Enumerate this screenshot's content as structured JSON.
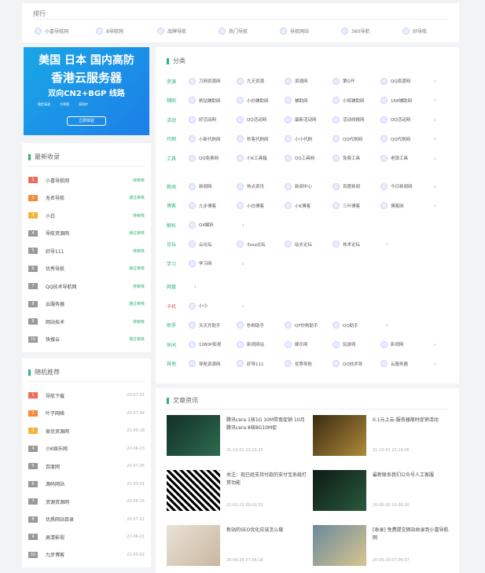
{
  "rank": {
    "title": "排行",
    "items": [
      "小喜导航网",
      "8导航网",
      "品牌导航",
      "热门导航",
      "导航网站",
      "360导航",
      "好导航"
    ]
  },
  "ad": {
    "line1": "美国 日本 国内高防",
    "line2": "香港云服务器",
    "line3": "双向CN2+BGP 线路",
    "chips": [
      "稳定高速",
      "大带宽",
      "高防护"
    ],
    "button": "立即体验"
  },
  "latest": {
    "title": "最新收录",
    "rows": [
      {
        "n": "1",
        "name": "小喜导航网",
        "status": "待审核"
      },
      {
        "n": "2",
        "name": "无名导航",
        "status": "通过审核"
      },
      {
        "n": "3",
        "name": "小白",
        "status": "待审核"
      },
      {
        "n": "4",
        "name": "导航资源网",
        "status": "通过审核"
      },
      {
        "n": "5",
        "name": "好导111",
        "status": "待审核"
      },
      {
        "n": "6",
        "name": "优秀导航",
        "status": "通过审核"
      },
      {
        "n": "7",
        "name": "QQ技术导航网",
        "status": "待审核"
      },
      {
        "n": "8",
        "name": "云服务器",
        "status": "通过审核"
      },
      {
        "n": "9",
        "name": "网站技术",
        "status": "待审核"
      },
      {
        "n": "10",
        "name": "快搜云",
        "status": "通过审核"
      }
    ]
  },
  "random": {
    "title": "随机推荐",
    "rows": [
      {
        "n": "1",
        "name": "导航下载",
        "date": "20-07-01"
      },
      {
        "n": "2",
        "name": "叶子网络",
        "date": "20-07-04"
      },
      {
        "n": "3",
        "name": "易优资源网",
        "date": "21-05-18"
      },
      {
        "n": "4",
        "name": "小K娱乐网",
        "date": "20-06-23"
      },
      {
        "n": "5",
        "name": "百度网",
        "date": "20-07-05"
      },
      {
        "n": "6",
        "name": "源码网站",
        "date": "21-03-01"
      },
      {
        "n": "7",
        "name": "资源资源网",
        "date": "20-06-25"
      },
      {
        "n": "8",
        "name": "优质网站目录",
        "date": "20-07-01"
      },
      {
        "n": "9",
        "name": "高清影视",
        "date": "21-06-21"
      },
      {
        "n": "10",
        "name": "九步博客",
        "date": "21-05-02"
      }
    ]
  },
  "categories": {
    "title": "分类",
    "rows": [
      {
        "label": "资源",
        "red": false,
        "items": [
          "刀网资源网",
          "九天资源",
          "资源网",
          "第Q开",
          "QQ资源网"
        ],
        "more": true
      },
      {
        "label": "辅助",
        "red": false,
        "items": [
          "刷钻辅助网",
          "小白辅助网",
          "辅助网",
          "小辉辅助网",
          "168辅助网"
        ],
        "more": true
      },
      {
        "label": "活动",
        "red": false,
        "items": [
          "好活动网",
          "QQ活动网",
          "最新活动网",
          "活动线报网",
          "QQ活动网"
        ],
        "more": true
      },
      {
        "label": "代刷",
        "red": false,
        "items": [
          "小新代刷网",
          "秒客代刷网",
          "小小代刷",
          "QQ代刷网",
          "QQ代刷网"
        ],
        "more": true
      },
      {
        "label": "工具",
        "red": false,
        "items": [
          "QQ免费网",
          "小K工具箱",
          "QQ工具网",
          "免费工具",
          "老铁工具"
        ],
        "more": true
      },
      {
        "label": "新闻",
        "red": false,
        "items": [
          "新闻网",
          "热点资讯",
          "新闻中心",
          "百度新闻",
          "今日新闻网"
        ],
        "more": true
      },
      {
        "label": "博客",
        "red": false,
        "items": [
          "九步博客",
          "小白博客",
          "小K博客",
          "三叶博客",
          "博客网"
        ],
        "more": true
      },
      {
        "label": "解析",
        "red": false,
        "items": [
          "Q4解析"
        ],
        "more": true
      },
      {
        "label": "论坛",
        "red": false,
        "items": [
          "云论坛",
          "3ssq论坛",
          "站长论坛",
          "技术论坛"
        ],
        "more": true
      },
      {
        "label": "学习",
        "red": false,
        "items": [
          "学习网"
        ],
        "more": true
      },
      {
        "label": "网盘",
        "red": false,
        "items": [],
        "more": true
      },
      {
        "label": "卡机",
        "red": true,
        "items": [
          "小小"
        ],
        "more": true
      },
      {
        "label": "助手",
        "red": false,
        "items": [
          "天天开助手",
          "秒刷助手",
          "QF秒刷助手",
          "QQ助手"
        ],
        "more": true
      },
      {
        "label": "休闲",
        "red": false,
        "items": [
          "1080P影视",
          "影视网站",
          "娱乐网",
          "玩游戏",
          "影视网"
        ],
        "more": true
      },
      {
        "label": "其他",
        "red": false,
        "items": [
          "导航资源网",
          "好导111",
          "优秀导航",
          "QQ技术导",
          "云服务器"
        ],
        "more": true
      }
    ]
  },
  "news": {
    "title": "文章资讯",
    "items": [
      {
        "text": "腾讯cera 1核1G 10M带宽促销 10月 腾讯cera 8核8G10M促",
        "date": "21-10-01 23:10:25"
      },
      {
        "text": "0.1元上云-服务器限时促销活动",
        "date": "21-10-01 23:10:06"
      },
      {
        "text": "关注：现已经支持付款的支付宝系统打赏功能",
        "date": "21-02-23 00:02:33"
      },
      {
        "text": "最新联系我们公众号人工客服",
        "date": "20-06-30 10:06:30"
      },
      {
        "text": "新站的SEO优化应该怎么做",
        "date": "20-06-26 07:06:16"
      },
      {
        "text": "[收录] 免费提交网站收录到小喜导航网",
        "date": "20-06-26 07:06:07"
      }
    ]
  },
  "colors": {
    "accent": "#2bb673",
    "red": "#e05c5c",
    "ad": "#1c7ee8"
  }
}
